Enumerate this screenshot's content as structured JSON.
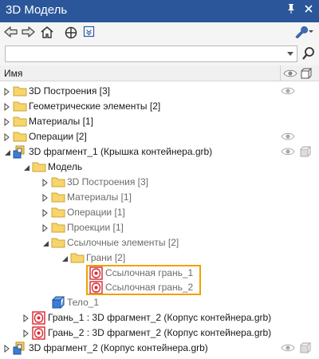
{
  "window": {
    "title": "3D Модель"
  },
  "titlebar": {
    "pin_glyph": "🖈",
    "close_glyph": "✕"
  },
  "search": {
    "value": "",
    "placeholder": ""
  },
  "column": {
    "name_header": "Имя"
  },
  "tree": {
    "items": [
      {
        "label": "3D Построения [3]"
      },
      {
        "label": "Геометрические элементы [2]"
      },
      {
        "label": "Материалы [1]"
      },
      {
        "label": "Операции [2]"
      },
      {
        "label": "3D фрагмент_1 (Крышка контейнера.grb)"
      },
      {
        "label": "Модель"
      },
      {
        "label": "3D Построения [3]"
      },
      {
        "label": "Материалы [1]"
      },
      {
        "label": "Операции [1]"
      },
      {
        "label": "Проекции [1]"
      },
      {
        "label": "Ссылочные элементы [2]"
      },
      {
        "label": "Грани [2]"
      },
      {
        "label": "Ссылочная грань_1"
      },
      {
        "label": "Ссылочная грань_2"
      },
      {
        "label": "Тело_1"
      },
      {
        "label": "Грань_1 : 3D фрагмент_2 (Корпус контейнера.grb)"
      },
      {
        "label": "Грань_2 : 3D фрагмент_2 (Корпус контейнера.grb)"
      },
      {
        "label": "3D фрагмент_2 (Корпус контейнера.grb)"
      }
    ]
  },
  "colors": {
    "titlebar": "#2b579a",
    "folder": "#f7d56b",
    "highlight": "#f0a000",
    "face_icon": "#d9262f"
  }
}
